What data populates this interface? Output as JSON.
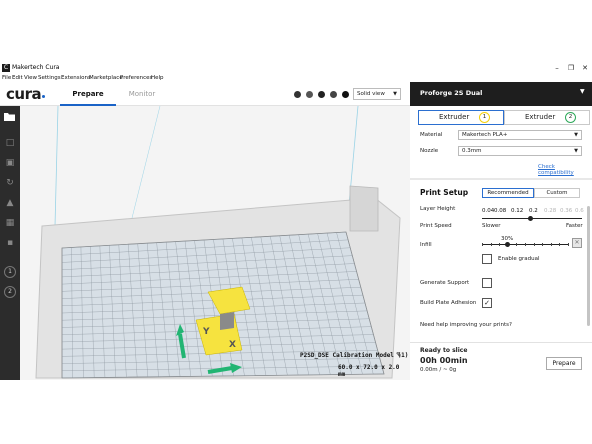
{
  "window": {
    "title": "Makertech Cura",
    "icon_letter": "C"
  },
  "menu": [
    "File",
    "Edit",
    "View",
    "Settings",
    "Extensions",
    "Marketplace",
    "Preferences",
    "Help"
  ],
  "header": {
    "logo": "cura",
    "tabs": [
      {
        "label": "Prepare",
        "active": true
      },
      {
        "label": "Monitor",
        "active": false
      }
    ],
    "view_select": "Solid view"
  },
  "machine": {
    "name": "Proforge 2S Dual"
  },
  "extruders": [
    {
      "label": "Extruder",
      "number": "1",
      "active": true,
      "color": "#f5d20a"
    },
    {
      "label": "Extruder",
      "number": "2",
      "active": false,
      "color": "#2ea85a"
    }
  ],
  "material": {
    "label": "Material",
    "value": "Makertech PLA+"
  },
  "nozzle": {
    "label": "Nozzle",
    "value": "0.3mm"
  },
  "check_compat": "Check compatibility",
  "print_setup": {
    "title": "Print Setup",
    "modes": [
      {
        "label": "Recommended",
        "active": true
      },
      {
        "label": "Custom",
        "active": false
      }
    ],
    "layer_height": {
      "label": "Layer Height",
      "values": [
        "0.04",
        "0.08",
        "0.12",
        "0.2",
        "0.28",
        "0.36",
        "0.6"
      ],
      "selected": "0.2"
    },
    "print_speed": {
      "label": "Print Speed",
      "min_label": "Slower",
      "max_label": "Faster"
    },
    "infill": {
      "label": "Infill",
      "value_text": "30%",
      "value": 30
    },
    "enable_gradual": {
      "label": "Enable gradual",
      "checked": false
    },
    "generate_support": {
      "label": "Generate Support",
      "checked": false
    },
    "adhesion": {
      "label": "Build Plate Adhesion",
      "checked": true
    },
    "help": "Need help improving your prints?"
  },
  "slice": {
    "title": "Ready to slice",
    "time": "00h 00min",
    "usage": "0.00m / ~ 0g",
    "button": "Prepare"
  },
  "object": {
    "name": "P2SD_DSE Calibration Model (1)",
    "dims": "60.0 x 72.0 x 2.0 mm"
  },
  "model_letters": {
    "y": "Y",
    "x": "X"
  },
  "toolbar": {
    "tools": [
      "folder-icon",
      "move-icon",
      "scale-icon",
      "rotate-icon",
      "mirror-icon",
      "per-model-settings-icon",
      "support-blocker-icon"
    ],
    "extruder_buttons": [
      "1",
      "2"
    ]
  }
}
